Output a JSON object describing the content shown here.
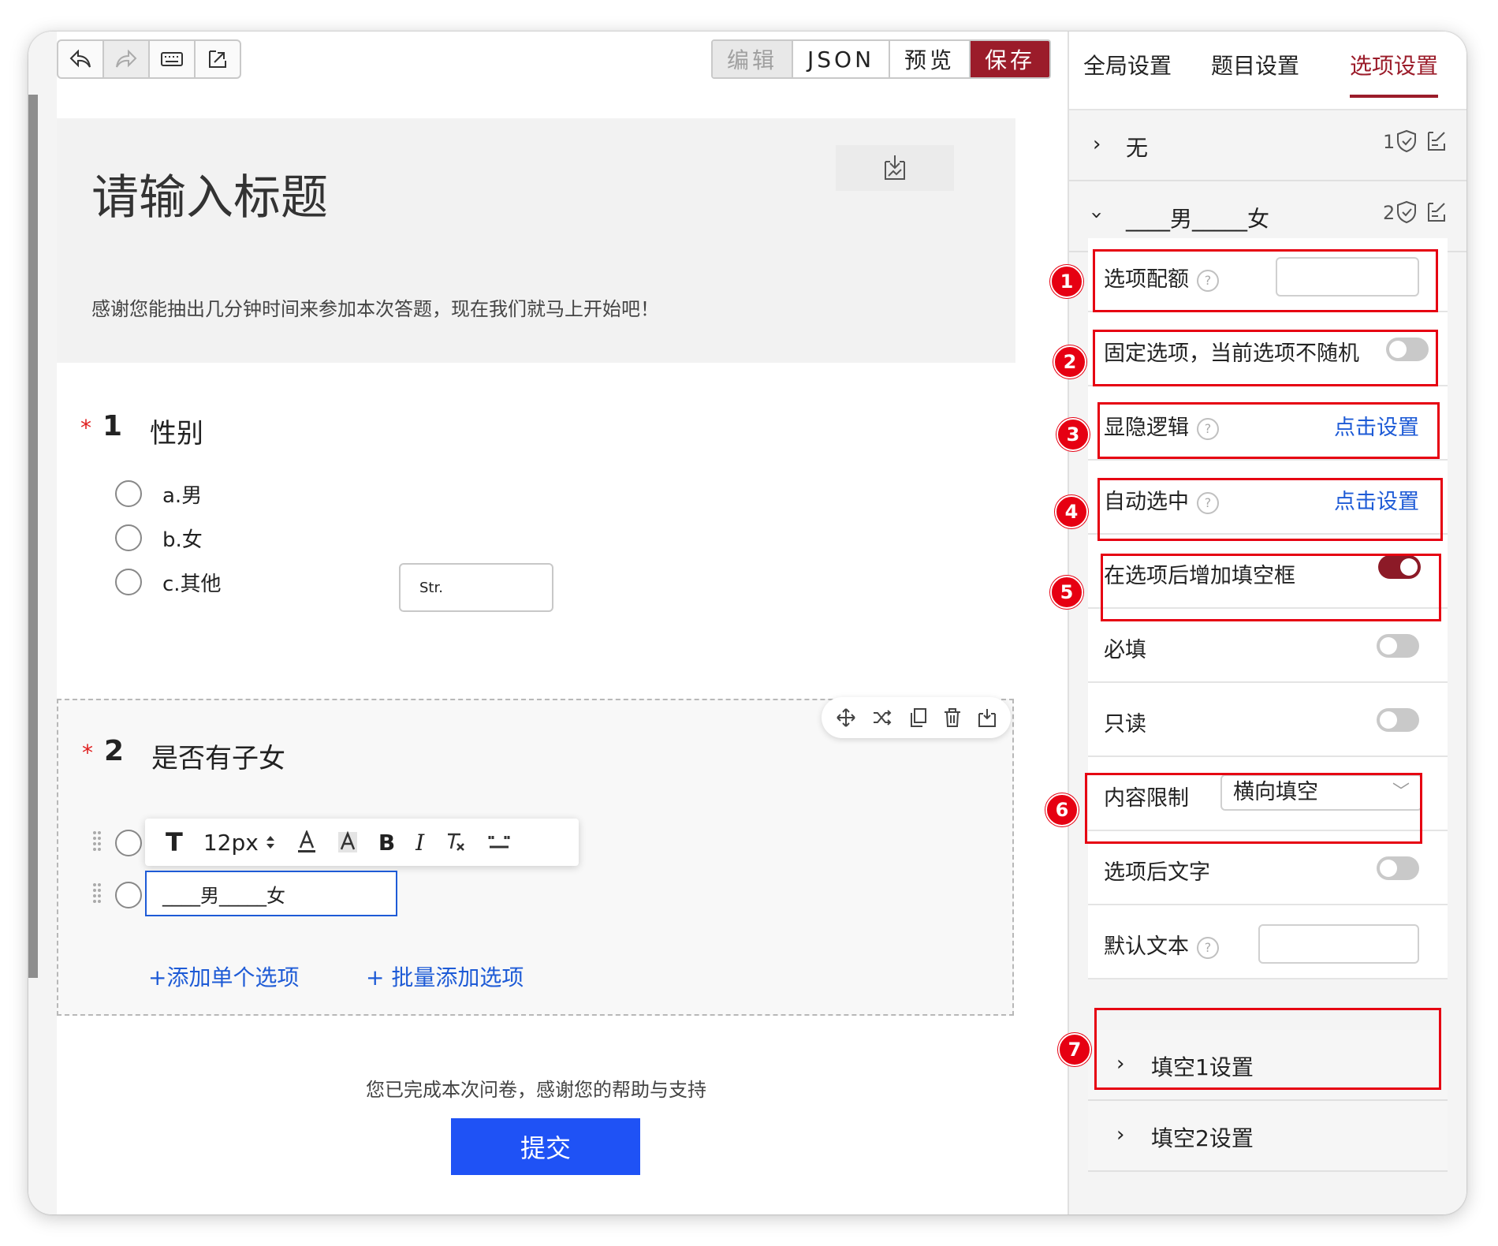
{
  "toolbar": {
    "undo_icon": "undo-icon",
    "redo_icon": "redo-icon",
    "keyboard_icon": "keyboard-icon",
    "import_icon": "import-icon",
    "modes": {
      "edit": "编辑",
      "json": "JSON",
      "preview": "预览",
      "save": "保存"
    }
  },
  "survey": {
    "title": "请输入标题",
    "description": "感谢您能抽出几分钟时间来参加本次答题，现在我们就马上开始吧！",
    "questions": [
      {
        "required": "*",
        "number": "1",
        "title": "性别",
        "options": [
          "a.男",
          "b.女",
          "c.其他"
        ],
        "fill_placeholder": "Str."
      },
      {
        "required": "*",
        "number": "2",
        "title": "是否有子女",
        "option_edit_value": "____男_____女",
        "add_single": "+添加单个选项",
        "add_batch": "+ 批量添加选项"
      }
    ],
    "format_bar": {
      "text_icon": "T",
      "font_size": "12px",
      "bold": "B",
      "italic": "I"
    },
    "thanks": "您已完成本次问卷，感谢您的帮助与支持",
    "submit": "提交"
  },
  "panel": {
    "tabs": [
      "全局设置",
      "题目设置",
      "选项设置"
    ],
    "active_tab": "选项设置",
    "groups": [
      {
        "label": "无",
        "count": "1"
      },
      {
        "label": "____男_____女",
        "count": "2"
      }
    ],
    "rows": {
      "quota": "选项配额",
      "fixed": "固定选项，当前选项不随机",
      "logic": "显隐逻辑",
      "logic_link": "点击设置",
      "auto_select": "自动选中",
      "auto_select_link": "点击设置",
      "add_fill": "在选项后增加填空框",
      "required": "必填",
      "readonly": "只读",
      "content_limit": "内容限制",
      "content_limit_value": "横向填空",
      "after_text": "选项后文字",
      "default_text": "默认文本"
    },
    "fill_groups": [
      "填空1设置",
      "填空2设置"
    ]
  },
  "annotations": [
    "1",
    "2",
    "3",
    "4",
    "5",
    "6",
    "7"
  ],
  "colors": {
    "accent": "#9b1c2a",
    "link": "#1e5bd6",
    "submit": "#1f52f5",
    "annotation": "#e60012"
  }
}
